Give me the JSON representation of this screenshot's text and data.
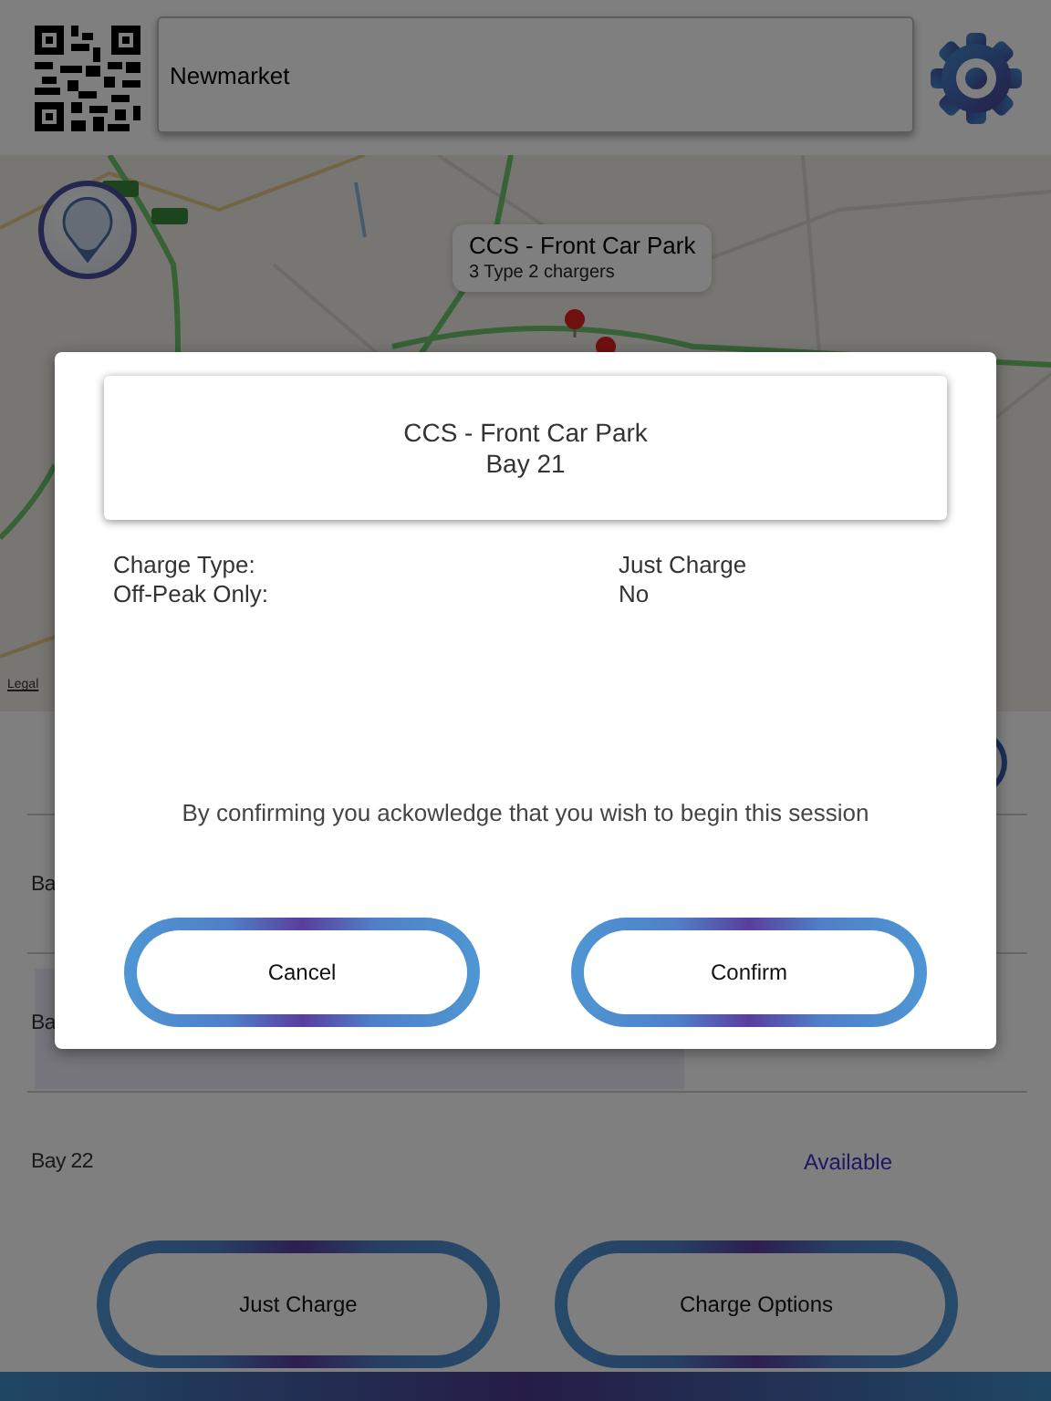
{
  "header": {
    "search_value": "Newmarket"
  },
  "map": {
    "callout": {
      "title": "CCS - Front Car Park",
      "subtitle": "3 Type 2 chargers"
    },
    "legal_link": "Legal"
  },
  "bays": [
    {
      "label": "Ba",
      "selected": false
    },
    {
      "label": "Ba",
      "selected": true
    },
    {
      "label": "Bay 22",
      "selected": false,
      "status": "Available"
    }
  ],
  "actions": [
    "Just Charge",
    "Charge Options"
  ],
  "modal": {
    "title": "CCS - Front Car Park",
    "subtitle": "Bay 21",
    "details": [
      {
        "label": "Charge Type:",
        "value": "Just Charge"
      },
      {
        "label": "Off-Peak Only:",
        "value": "No"
      }
    ],
    "message": "By confirming you ackowledge that you wish to begin this session",
    "buttons": [
      "Cancel",
      "Confirm"
    ]
  }
}
